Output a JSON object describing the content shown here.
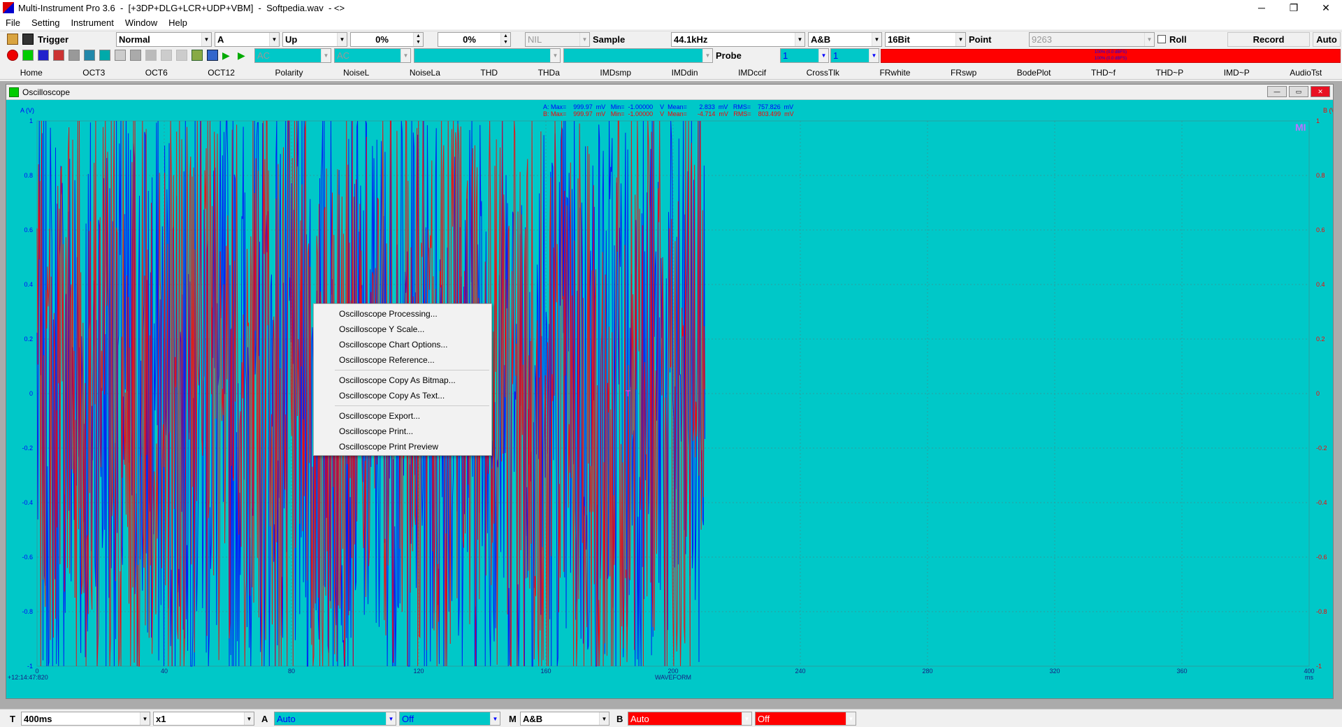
{
  "window": {
    "title": "Multi-Instrument Pro 3.6  -  [+3DP+DLG+LCR+UDP+VBM]  -  Softpedia.wav  - <>",
    "minimize": "─",
    "maximize": "❐",
    "close": "✕"
  },
  "menu": [
    "File",
    "Setting",
    "Instrument",
    "Window",
    "Help"
  ],
  "toolbar1": {
    "trigger_label": "Trigger",
    "trigger_mode": "Normal",
    "trigger_channel": "A",
    "trigger_edge": "Up",
    "trigger_level": "0%",
    "trigger_delay": "0%",
    "nil": "NIL",
    "sample_label": "Sample",
    "sample_rate": "44.1kHz",
    "channels": "A&B",
    "bits": "16Bit",
    "point_label": "Point",
    "points": "9263",
    "roll_label": "Roll",
    "record_label": "Record",
    "auto_label": "Auto"
  },
  "toolbar2": {
    "coupling_a": "AC",
    "coupling_b": "AC",
    "probe_label": "Probe",
    "probe_a": "1",
    "probe_b": "1",
    "level_a": "100% (0.0 dBFS)",
    "level_b": "100% (0.0 dBFS)"
  },
  "tabs": [
    "Home",
    "OCT3",
    "OCT6",
    "OCT12",
    "Polarity",
    "NoiseL",
    "NoiseLa",
    "THD",
    "THDa",
    "IMDsmp",
    "IMDdin",
    "IMDccif",
    "CrossTlk",
    "FRwhite",
    "FRswp",
    "BodePlot",
    "THD~f",
    "THD~P",
    "IMD~P",
    "AudioTst"
  ],
  "oscilloscope": {
    "title": "Oscilloscope",
    "stats_a": "A: Max=    999.97  mV   Min=  -1.00000    V  Mean=       2.833  mV   RMS=    757.826  mV",
    "stats_b": "B: Max=    999.97  mV   Min=  -1.00000    V  Mean=      -4.714  mV   RMS=    803.499  mV",
    "trace_marker": "T",
    "corner_logo": "MI",
    "timestamp": "+12:14:47:820",
    "colors": {
      "background": "#00c8c8",
      "channel_a": "#0000ff",
      "channel_b": "#ff0000"
    }
  },
  "context_menu": {
    "items": [
      "Oscilloscope Processing...",
      "Oscilloscope Y Scale...",
      "Oscilloscope Chart Options...",
      "Oscilloscope Reference...",
      "Oscilloscope Copy As Bitmap...",
      "Oscilloscope Copy As Text...",
      "Oscilloscope Export...",
      "Oscilloscope Print...",
      "Oscilloscope Print Preview"
    ]
  },
  "bottom": {
    "t_label": "T",
    "timebase": "400ms",
    "zoom": "x1",
    "a_label": "A",
    "a_range": "Auto",
    "a_offset": "Off",
    "m_label": "M",
    "mode": "A&B",
    "b_label": "B",
    "b_range": "Auto",
    "b_offset": "Off"
  },
  "chart_data": {
    "type": "line",
    "title": "",
    "xlabel": "WAVEFORM",
    "x_unit": "ms",
    "ylabel_left": "A (V)",
    "ylabel_right": "B (V)",
    "xlim": [
      0,
      400
    ],
    "ylim": [
      -1,
      1
    ],
    "x_ticks": [
      0,
      40,
      80,
      120,
      160,
      200,
      240,
      280,
      320,
      360,
      400
    ],
    "y_ticks": [
      1,
      0.8,
      0.6,
      0.4,
      0.2,
      0,
      -0.2,
      -0.4,
      -0.6,
      -0.8,
      -1
    ],
    "grid": true,
    "data_extent_ms": 210,
    "series": [
      {
        "channel": "A",
        "color": "#0000ff",
        "max": 0.99997,
        "min": -1.0,
        "mean": 0.002833,
        "rms": 0.757826
      },
      {
        "channel": "B",
        "color": "#ff0000",
        "max": 0.99997,
        "min": -1.0,
        "mean": -0.004714,
        "rms": 0.803499
      }
    ]
  }
}
